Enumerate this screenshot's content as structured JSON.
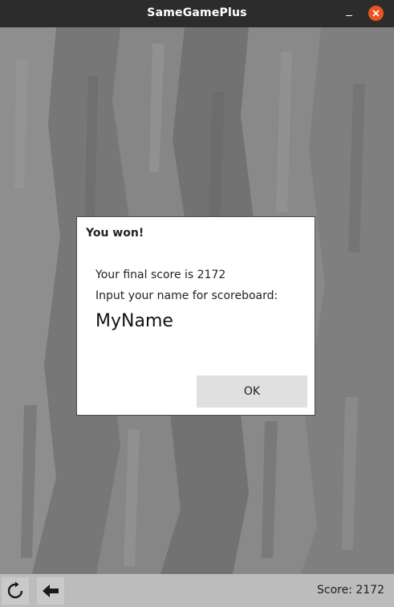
{
  "window": {
    "title": "SameGamePlus"
  },
  "dialog": {
    "title": "You won!",
    "score_message": "Your final score is 2172",
    "prompt": "Input your name for scoreboard:",
    "name_value": "MyName",
    "ok_label": "OK"
  },
  "toolbar": {
    "restart_icon": "restart-icon",
    "back_icon": "back-arrow-icon",
    "score_text": "Score: 2172"
  },
  "colors": {
    "titlebar": "#2c2c2c",
    "close_button": "#e95420",
    "toolbar": "#bcbcbc",
    "game_background": "#7b7b7b"
  }
}
